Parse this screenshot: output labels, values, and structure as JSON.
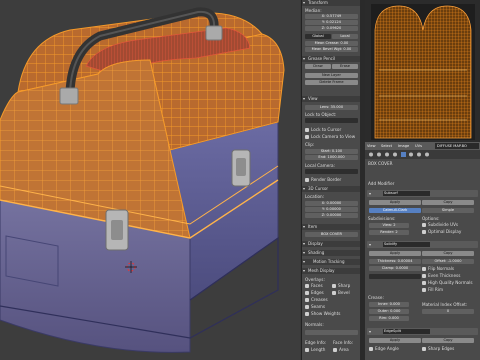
{
  "viewport": {
    "description_label": "",
    "cursor_icon": "3d-cursor-icon"
  },
  "npanel": {
    "transform_header": "Transform",
    "median_label": "Median:",
    "x_label": "X:",
    "x_value": "0.57749",
    "y_label": "Y:",
    "y_value": "0.02124",
    "z_label": "Z:",
    "z_value": "0.09620",
    "global_btn": "Global",
    "local_btn": "Local",
    "mean_crease_label": "Mean Crease:",
    "mean_crease_value": "0.00",
    "mean_bevel_label": "Mean Bevel Wgt:",
    "mean_bevel_value": "0.00",
    "grease_pencil_header": "Grease Pencil",
    "draw_btn": "Draw",
    "erase_btn": "Erase",
    "new_layer_btn": "New Layer",
    "delete_frame_btn": "Delete Frame",
    "view_header": "View",
    "lens_label": "Lens:",
    "lens_value": "35.000",
    "lock_object_label": "Lock to Object:",
    "lock_cursor_label": "Lock to Cursor",
    "lock_camera_label": "Lock Camera to View",
    "clip_label": "Clip:",
    "start_label": "Start:",
    "start_value": "0.100",
    "end_label": "End:",
    "end_value": "1000.000",
    "local_camera_label": "Local Camera:",
    "render_border_label": "Render Border",
    "cursor_header": "3D Cursor",
    "location_label": "Location:",
    "cx_label": "X:",
    "cx_value": "0.00000",
    "cy_label": "Y:",
    "cy_value": "0.00000",
    "cz_label": "Z:",
    "cz_value": "0.00000",
    "item_header": "Item",
    "item_name": "BOX COVER",
    "display_header": "Display",
    "shading_header": "Shading",
    "motion_tracking_label": "Motion Tracking",
    "mesh_display_header": "Mesh Display",
    "overlays_label": "Overlays:",
    "faces_label": "Faces",
    "sharp_label": "Sharp",
    "edges_label": "Edges",
    "bevel_label": "Bevel",
    "creases_label": "Creases",
    "seams_label": "Seams",
    "show_weights_label": "Show Weights",
    "normals_label": "Normals:",
    "edge_info_label": "Edge Info:",
    "face_info_label": "Face Info:",
    "length_label": "Length",
    "area_label": "Area"
  },
  "uv_editor": {
    "view_menu": "View",
    "select_menu": "Select",
    "image_menu": "Image",
    "uvs_menu": "UVs",
    "image_name": "DIFFUSE MAP.BO",
    "object_label": "BOX COVER",
    "accent_color": "#f08a1c"
  },
  "properties": {
    "object_name": "BOX COVER",
    "add_modifier_label": "Add Modifier",
    "modifiers": [
      {
        "name": "Subsurf",
        "apply": "Apply",
        "copy": "Copy"
      },
      {
        "name": "Solidify",
        "apply": "Apply",
        "copy": "Copy"
      },
      {
        "name": "EdgeSplit",
        "apply": "Apply",
        "copy": "Copy"
      }
    ],
    "catmull_btn": "Catmull-Clark",
    "simple_btn": "Simple",
    "subdivisions_label": "Subdivisions:",
    "view_label": "View:",
    "view_value": "2",
    "render_label": "Render:",
    "render_value": "2",
    "options_label": "Options:",
    "subdivide_uvs": "Subdivide UVs",
    "optimal_display": "Optimal Display",
    "thickness_label": "Thickness:",
    "thickness_value": "0.00004",
    "offset_label": "Offset:",
    "offset_value": "-1.0000",
    "clamp_label": "Clamp:",
    "clamp_value": "0.0000",
    "flip_normals": "Flip Normals",
    "even_thickness": "Even Thickness",
    "high_quality_normals": "High Quality Normals",
    "fill_rim": "Fill Rim",
    "vertex_group_label": "Vertex Group:",
    "factor_label": "Factor:",
    "crease_label": "Crease:",
    "inner_label": "Inner:",
    "inner_value": "0.000",
    "outer_label": "Outer:",
    "outer_value": "0.000",
    "rim_label": "Rim:",
    "rim_value": "0.000",
    "material_index_label": "Material Index Offset:",
    "mat_value": "0",
    "edge_angle_label": "Edge Angle",
    "sharp_edges_label": "Sharp Edges"
  },
  "colors": {
    "wire": "#f08a1c",
    "box_body": "#56568a",
    "box_top": "#a05a2c",
    "selected_red": "#c0392b"
  }
}
